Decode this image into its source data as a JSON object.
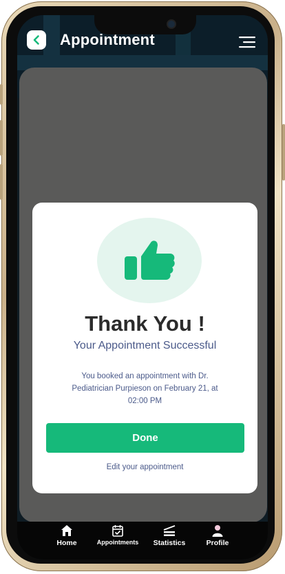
{
  "header": {
    "title": "Appointment",
    "back_icon": "chevron-left-icon",
    "menu_icon": "menu-icon"
  },
  "modal": {
    "icon": "thumbs-up-icon",
    "heading": "Thank You !",
    "subheading": "Your Appointment Successful",
    "message": "You booked an appointment with Dr. Pediatrician Purpieson on February 21, at 02:00 PM",
    "done_label": "Done",
    "edit_label": "Edit your appointment"
  },
  "bottom_nav": {
    "items": [
      {
        "label": "Home",
        "icon": "home-icon"
      },
      {
        "label": "Appointments",
        "icon": "calendar-check-icon"
      },
      {
        "label": "Statistics",
        "icon": "statistics-icon"
      },
      {
        "label": "Profile",
        "icon": "profile-icon"
      }
    ]
  },
  "colors": {
    "accent": "#16b97a",
    "icon_bg": "#e4f5ee",
    "text_muted": "#4b5a8a",
    "overlay": "#5a5a59"
  }
}
